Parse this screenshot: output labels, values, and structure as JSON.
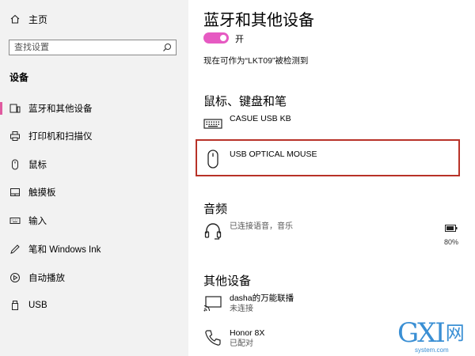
{
  "sidebar": {
    "home_label": "主页",
    "search_placeholder": "查找设置",
    "section_title": "设备",
    "items": [
      {
        "label": "蓝牙和其他设备",
        "icon": "bluetooth-devices-icon",
        "selected": true
      },
      {
        "label": "打印机和扫描仪",
        "icon": "printer-icon",
        "selected": false
      },
      {
        "label": "鼠标",
        "icon": "mouse-icon",
        "selected": false
      },
      {
        "label": "触摸板",
        "icon": "touchpad-icon",
        "selected": false
      },
      {
        "label": "输入",
        "icon": "keyboard-icon",
        "selected": false
      },
      {
        "label": "笔和 Windows Ink",
        "icon": "pen-icon",
        "selected": false
      },
      {
        "label": "自动播放",
        "icon": "autoplay-icon",
        "selected": false
      },
      {
        "label": "USB",
        "icon": "usb-icon",
        "selected": false
      }
    ]
  },
  "main": {
    "title": "蓝牙和其他设备",
    "bluetooth_toggle": {
      "on": true,
      "label": "开"
    },
    "discoverable_text": "现在可作为“LKT09”被检测到",
    "sections": {
      "input": {
        "title": "鼠标、键盘和笔",
        "devices": [
          {
            "name": "CASUE USB KB",
            "icon": "keyboard-icon"
          },
          {
            "name": "USB OPTICAL MOUSE",
            "icon": "mouse-icon",
            "highlighted": true
          }
        ]
      },
      "audio": {
        "title": "音频",
        "devices": [
          {
            "name": "",
            "status": "已连接语音，音乐",
            "icon": "headset-icon",
            "battery": "80%"
          }
        ]
      },
      "other": {
        "title": "其他设备",
        "devices": [
          {
            "name": "dasha的万能联播",
            "status": "未连接",
            "icon": "cast-display-icon"
          },
          {
            "name": "Honor 8X",
            "status": "已配对",
            "icon": "phone-icon"
          }
        ]
      }
    }
  },
  "colors": {
    "accent": "#e65ac2",
    "highlight_border": "#b83228",
    "sidebar_bg": "#f2f2f2",
    "watermark": "#3a8fd4"
  },
  "watermark": {
    "brand": "GXI",
    "brand_cn": "网",
    "url": "system.com"
  }
}
